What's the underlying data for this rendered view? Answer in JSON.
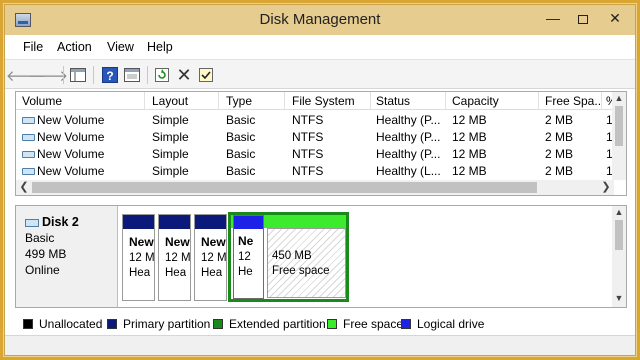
{
  "window": {
    "title": "Disk Management"
  },
  "menu": [
    "File",
    "Action",
    "View",
    "Help"
  ],
  "toolbar": {
    "icons": [
      "back-icon",
      "forward-icon",
      "console-tree-icon",
      "help-icon",
      "properties-icon",
      "refresh-icon",
      "delete-icon",
      "check-icon"
    ]
  },
  "volume_list": {
    "columns": [
      "Volume",
      "Layout",
      "Type",
      "File System",
      "Status",
      "Capacity",
      "Free Spa...",
      "%"
    ],
    "rows": [
      [
        "New Volume",
        "Simple",
        "Basic",
        "NTFS",
        "Healthy (P...",
        "12 MB",
        "2 MB",
        "1"
      ],
      [
        "New Volume",
        "Simple",
        "Basic",
        "NTFS",
        "Healthy (P...",
        "12 MB",
        "2 MB",
        "1"
      ],
      [
        "New Volume",
        "Simple",
        "Basic",
        "NTFS",
        "Healthy (P...",
        "12 MB",
        "2 MB",
        "1"
      ],
      [
        "New Volume",
        "Simple",
        "Basic",
        "NTFS",
        "Healthy (L...",
        "12 MB",
        "2 MB",
        "1"
      ]
    ]
  },
  "disk": {
    "name": "Disk 2",
    "type": "Basic",
    "size": "499 MB",
    "state": "Online"
  },
  "partitions": [
    {
      "name": "New",
      "size": "12 M",
      "status": "Hea"
    },
    {
      "name": "New",
      "size": "12 M",
      "status": "Hea"
    },
    {
      "name": "New",
      "size": "12 M",
      "status": "Hea"
    }
  ],
  "logical": {
    "name": "Ne",
    "size": "12",
    "status": "He"
  },
  "free_space": {
    "size": "450 MB",
    "label": "Free space"
  },
  "legend": [
    {
      "label": "Unallocated",
      "color": "#000000"
    },
    {
      "label": "Primary partition",
      "color": "#0b1a7a"
    },
    {
      "label": "Extended partition",
      "color": "#1a8a1a"
    },
    {
      "label": "Free space",
      "color": "#3cec2c"
    },
    {
      "label": "Logical drive",
      "color": "#1d22e6"
    }
  ]
}
